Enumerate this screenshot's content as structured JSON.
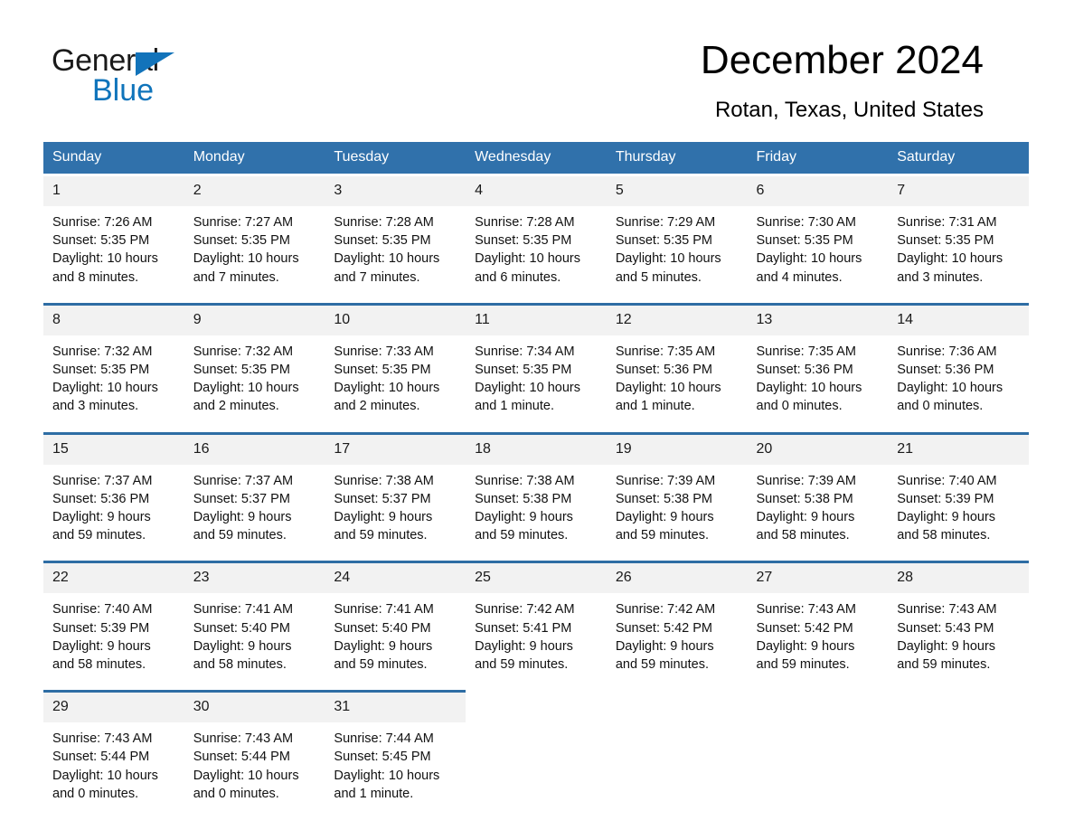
{
  "logo": {
    "text_top": "General",
    "text_bottom": "Blue",
    "triangle_color": "#1273ba",
    "blue_color": "#0f74bb"
  },
  "header": {
    "title": "December 2024",
    "location": "Rotan, Texas, United States"
  },
  "colors": {
    "header_blue": "#3071ab",
    "rule_blue": "#2e6da4",
    "daynum_bg": "#f2f2f2",
    "cell_bg": "#ffffff",
    "text": "#111111"
  },
  "weekday_headers": [
    "Sunday",
    "Monday",
    "Tuesday",
    "Wednesday",
    "Thursday",
    "Friday",
    "Saturday"
  ],
  "weeks": [
    [
      {
        "day": "1",
        "sunrise": "Sunrise: 7:26 AM",
        "sunset": "Sunset: 5:35 PM",
        "daylight_1": "Daylight: 10 hours",
        "daylight_2": "and 8 minutes."
      },
      {
        "day": "2",
        "sunrise": "Sunrise: 7:27 AM",
        "sunset": "Sunset: 5:35 PM",
        "daylight_1": "Daylight: 10 hours",
        "daylight_2": "and 7 minutes."
      },
      {
        "day": "3",
        "sunrise": "Sunrise: 7:28 AM",
        "sunset": "Sunset: 5:35 PM",
        "daylight_1": "Daylight: 10 hours",
        "daylight_2": "and 7 minutes."
      },
      {
        "day": "4",
        "sunrise": "Sunrise: 7:28 AM",
        "sunset": "Sunset: 5:35 PM",
        "daylight_1": "Daylight: 10 hours",
        "daylight_2": "and 6 minutes."
      },
      {
        "day": "5",
        "sunrise": "Sunrise: 7:29 AM",
        "sunset": "Sunset: 5:35 PM",
        "daylight_1": "Daylight: 10 hours",
        "daylight_2": "and 5 minutes."
      },
      {
        "day": "6",
        "sunrise": "Sunrise: 7:30 AM",
        "sunset": "Sunset: 5:35 PM",
        "daylight_1": "Daylight: 10 hours",
        "daylight_2": "and 4 minutes."
      },
      {
        "day": "7",
        "sunrise": "Sunrise: 7:31 AM",
        "sunset": "Sunset: 5:35 PM",
        "daylight_1": "Daylight: 10 hours",
        "daylight_2": "and 3 minutes."
      }
    ],
    [
      {
        "day": "8",
        "sunrise": "Sunrise: 7:32 AM",
        "sunset": "Sunset: 5:35 PM",
        "daylight_1": "Daylight: 10 hours",
        "daylight_2": "and 3 minutes."
      },
      {
        "day": "9",
        "sunrise": "Sunrise: 7:32 AM",
        "sunset": "Sunset: 5:35 PM",
        "daylight_1": "Daylight: 10 hours",
        "daylight_2": "and 2 minutes."
      },
      {
        "day": "10",
        "sunrise": "Sunrise: 7:33 AM",
        "sunset": "Sunset: 5:35 PM",
        "daylight_1": "Daylight: 10 hours",
        "daylight_2": "and 2 minutes."
      },
      {
        "day": "11",
        "sunrise": "Sunrise: 7:34 AM",
        "sunset": "Sunset: 5:35 PM",
        "daylight_1": "Daylight: 10 hours",
        "daylight_2": "and 1 minute."
      },
      {
        "day": "12",
        "sunrise": "Sunrise: 7:35 AM",
        "sunset": "Sunset: 5:36 PM",
        "daylight_1": "Daylight: 10 hours",
        "daylight_2": "and 1 minute."
      },
      {
        "day": "13",
        "sunrise": "Sunrise: 7:35 AM",
        "sunset": "Sunset: 5:36 PM",
        "daylight_1": "Daylight: 10 hours",
        "daylight_2": "and 0 minutes."
      },
      {
        "day": "14",
        "sunrise": "Sunrise: 7:36 AM",
        "sunset": "Sunset: 5:36 PM",
        "daylight_1": "Daylight: 10 hours",
        "daylight_2": "and 0 minutes."
      }
    ],
    [
      {
        "day": "15",
        "sunrise": "Sunrise: 7:37 AM",
        "sunset": "Sunset: 5:36 PM",
        "daylight_1": "Daylight: 9 hours",
        "daylight_2": "and 59 minutes."
      },
      {
        "day": "16",
        "sunrise": "Sunrise: 7:37 AM",
        "sunset": "Sunset: 5:37 PM",
        "daylight_1": "Daylight: 9 hours",
        "daylight_2": "and 59 minutes."
      },
      {
        "day": "17",
        "sunrise": "Sunrise: 7:38 AM",
        "sunset": "Sunset: 5:37 PM",
        "daylight_1": "Daylight: 9 hours",
        "daylight_2": "and 59 minutes."
      },
      {
        "day": "18",
        "sunrise": "Sunrise: 7:38 AM",
        "sunset": "Sunset: 5:38 PM",
        "daylight_1": "Daylight: 9 hours",
        "daylight_2": "and 59 minutes."
      },
      {
        "day": "19",
        "sunrise": "Sunrise: 7:39 AM",
        "sunset": "Sunset: 5:38 PM",
        "daylight_1": "Daylight: 9 hours",
        "daylight_2": "and 59 minutes."
      },
      {
        "day": "20",
        "sunrise": "Sunrise: 7:39 AM",
        "sunset": "Sunset: 5:38 PM",
        "daylight_1": "Daylight: 9 hours",
        "daylight_2": "and 58 minutes."
      },
      {
        "day": "21",
        "sunrise": "Sunrise: 7:40 AM",
        "sunset": "Sunset: 5:39 PM",
        "daylight_1": "Daylight: 9 hours",
        "daylight_2": "and 58 minutes."
      }
    ],
    [
      {
        "day": "22",
        "sunrise": "Sunrise: 7:40 AM",
        "sunset": "Sunset: 5:39 PM",
        "daylight_1": "Daylight: 9 hours",
        "daylight_2": "and 58 minutes."
      },
      {
        "day": "23",
        "sunrise": "Sunrise: 7:41 AM",
        "sunset": "Sunset: 5:40 PM",
        "daylight_1": "Daylight: 9 hours",
        "daylight_2": "and 58 minutes."
      },
      {
        "day": "24",
        "sunrise": "Sunrise: 7:41 AM",
        "sunset": "Sunset: 5:40 PM",
        "daylight_1": "Daylight: 9 hours",
        "daylight_2": "and 59 minutes."
      },
      {
        "day": "25",
        "sunrise": "Sunrise: 7:42 AM",
        "sunset": "Sunset: 5:41 PM",
        "daylight_1": "Daylight: 9 hours",
        "daylight_2": "and 59 minutes."
      },
      {
        "day": "26",
        "sunrise": "Sunrise: 7:42 AM",
        "sunset": "Sunset: 5:42 PM",
        "daylight_1": "Daylight: 9 hours",
        "daylight_2": "and 59 minutes."
      },
      {
        "day": "27",
        "sunrise": "Sunrise: 7:43 AM",
        "sunset": "Sunset: 5:42 PM",
        "daylight_1": "Daylight: 9 hours",
        "daylight_2": "and 59 minutes."
      },
      {
        "day": "28",
        "sunrise": "Sunrise: 7:43 AM",
        "sunset": "Sunset: 5:43 PM",
        "daylight_1": "Daylight: 9 hours",
        "daylight_2": "and 59 minutes."
      }
    ],
    [
      {
        "day": "29",
        "sunrise": "Sunrise: 7:43 AM",
        "sunset": "Sunset: 5:44 PM",
        "daylight_1": "Daylight: 10 hours",
        "daylight_2": "and 0 minutes."
      },
      {
        "day": "30",
        "sunrise": "Sunrise: 7:43 AM",
        "sunset": "Sunset: 5:44 PM",
        "daylight_1": "Daylight: 10 hours",
        "daylight_2": "and 0 minutes."
      },
      {
        "day": "31",
        "sunrise": "Sunrise: 7:44 AM",
        "sunset": "Sunset: 5:45 PM",
        "daylight_1": "Daylight: 10 hours",
        "daylight_2": "and 1 minute."
      },
      null,
      null,
      null,
      null
    ]
  ]
}
